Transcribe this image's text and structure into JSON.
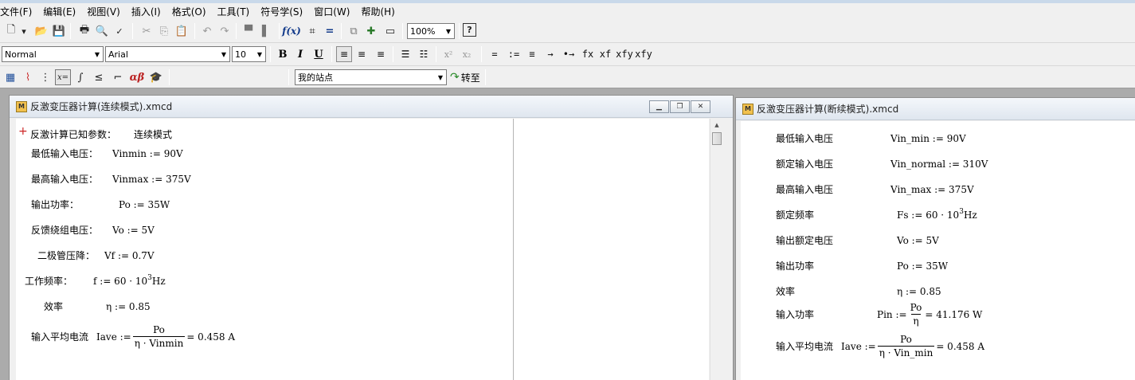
{
  "menu": [
    "文件(F)",
    "编辑(E)",
    "视图(V)",
    "插入(I)",
    "格式(O)",
    "工具(T)",
    "符号学(S)",
    "窗口(W)",
    "帮助(H)"
  ],
  "toolbar": {
    "zoom": "100%",
    "help_glyph": "?",
    "style": "Normal",
    "font": "Arial",
    "size": "10",
    "bold": "B",
    "italic": "I",
    "underline": "U",
    "sup": "x²",
    "sub": "x₂",
    "ops": [
      "=",
      ":=",
      "≡",
      "→",
      "•→",
      "fx",
      "xf",
      "xfy",
      "xfy"
    ],
    "site": "我的站点",
    "goto": "转至"
  },
  "win1": {
    "title": "反激变压器计算(连续模式).xmcd",
    "heading_label": "反激计算已知参数：",
    "heading_mode": "连续模式",
    "rows": [
      {
        "label": "最低输入电压：",
        "expr": "Vinmin := 90V"
      },
      {
        "label": "最高输入电压：",
        "expr": "Vinmax := 375V"
      },
      {
        "label": "输出功率：",
        "expr": "Po := 35W"
      },
      {
        "label": "反馈绕组电压：",
        "expr": "Vo := 5V"
      },
      {
        "label": "二极管压降：",
        "expr": "Vf := 0.7V"
      },
      {
        "label": "工作频率：",
        "expr_pre": "f := 60 · 10",
        "exp": "3",
        "expr_post": "Hz"
      },
      {
        "label": "效率",
        "expr": "η := 0.85"
      }
    ],
    "iave": {
      "label": "输入平均电流",
      "lhs": "Iave :=",
      "num": "Po",
      "den": "η · Vinmin",
      "result": "= 0.458 A"
    }
  },
  "win2": {
    "title": "反激变压器计算(断续模式).xmcd",
    "rows": [
      {
        "label": "最低输入电压",
        "expr": "Vin_min := 90V"
      },
      {
        "label": "额定输入电压",
        "expr": "Vin_normal := 310V"
      },
      {
        "label": "最高输入电压",
        "expr": "Vin_max := 375V"
      },
      {
        "label": "额定频率",
        "expr_pre": "Fs := 60 · 10",
        "exp": "3",
        "expr_post": "Hz"
      },
      {
        "label": "输出额定电压",
        "expr": "Vo := 5V"
      },
      {
        "label": "输出功率",
        "expr": "Po := 35W"
      },
      {
        "label": "效率",
        "expr": "η := 0.85"
      }
    ],
    "pin": {
      "label": "输入功率",
      "lhs": "Pin :=",
      "num": "Po",
      "den": "η",
      "result": "= 41.176 W"
    },
    "iave": {
      "label": "输入平均电流",
      "lhs": "Iave :=",
      "num": "Po",
      "den": "η · Vin_min",
      "result": "= 0.458 A"
    }
  }
}
